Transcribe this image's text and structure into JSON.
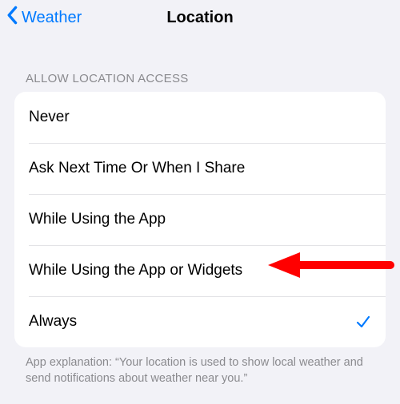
{
  "nav": {
    "back": "Weather",
    "title": "Location"
  },
  "section": {
    "header": "ALLOW LOCATION ACCESS",
    "options": [
      {
        "label": "Never",
        "selected": false
      },
      {
        "label": "Ask Next Time Or When I Share",
        "selected": false
      },
      {
        "label": "While Using the App",
        "selected": false
      },
      {
        "label": "While Using the App or Widgets",
        "selected": false
      },
      {
        "label": "Always",
        "selected": true
      }
    ],
    "footer": "App explanation: “Your location is used to show local weather and send notifications about weather near you.”"
  },
  "annotation": {
    "arrow_target_index": 3,
    "color": "#ff0000"
  }
}
